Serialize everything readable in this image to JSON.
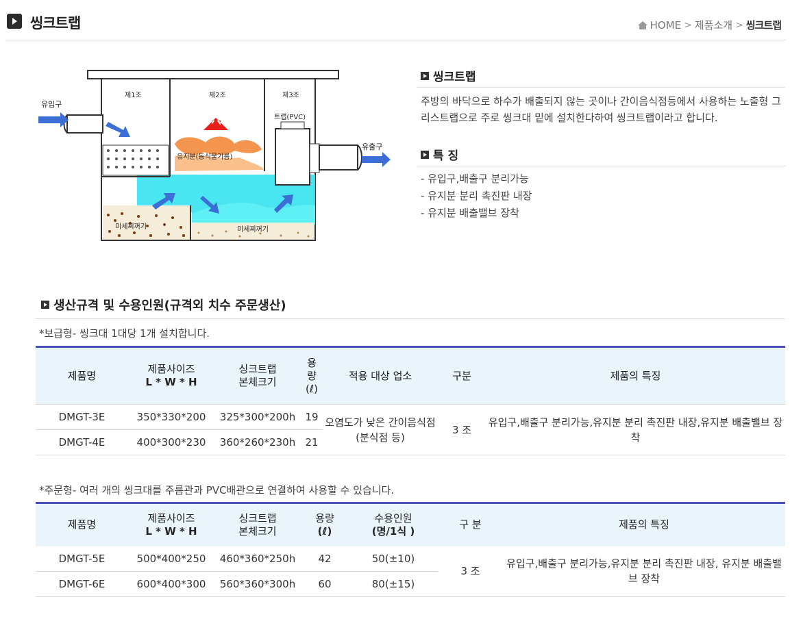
{
  "header": {
    "title": "씽크트랩",
    "breadcrumb": {
      "home": "HOME",
      "category": "제품소개",
      "current": "씽크트랩"
    }
  },
  "diagram": {
    "inlet": "유입구",
    "outlet": "유출구",
    "tank1": "제1조",
    "tank2": "제2조",
    "tank3": "제3조",
    "trap": "트랩(PVC)",
    "grease": "유지분(동식물기름)",
    "sediment1": "미세찌꺼기",
    "sediment2": "미세찌꺼기"
  },
  "intro": {
    "title": "씽크트랩",
    "description": "주방의 바닥으로 하수가 배출되지 않는 곳이나 간이음식점등에서 사용하는 노출형 그리스트랩으로 주로 씽크대 밑에 설치한다하여 씽크트랩이라고 합니다."
  },
  "features": {
    "title": "특 징",
    "items": [
      "- 유입구,배출구 분리가능",
      "- 유지분 분리 촉진판 내장",
      "- 유지분 배출밸브 장착"
    ]
  },
  "spec": {
    "title": "생산규격 및 수용인원(규격외 치수 주문생산)",
    "type1": {
      "note_label": "*보급형",
      "note_text": "- 씽크대 1대당 1개 설치합니다.",
      "headers": {
        "name": "제품명",
        "size1": "제품사이즈",
        "size2": "L * W * H",
        "body1": "싱크트랩",
        "body2": "본체크기",
        "cap1": "용",
        "cap2": "량",
        "cap3": "(ℓ)",
        "target": "적용 대상 업소",
        "div": "구분",
        "feature": "제품의 특징"
      },
      "rows": [
        {
          "name": "DMGT-3E",
          "size": "350*330*200",
          "body": "325*300*200h",
          "cap": "19"
        },
        {
          "name": "DMGT-4E",
          "size": "400*300*230",
          "body": "360*260*230h",
          "cap": "21"
        }
      ],
      "target": "오염도가 낮은 간이음식점(분식점 등)",
      "division": "3 조",
      "feature": "유입구,배출구 분리가능,유지분 분리 촉진판 내장,유지분 배출밸브 장착"
    },
    "type2": {
      "note_label": "*주문형",
      "note_text": "- 여러 개의 씽크대를 주름관과 PVC배관으로 연결하여 사용할 수 있습니다.",
      "headers": {
        "name": "제품명",
        "size1": "제품사이즈",
        "size2": "L * W * H",
        "body1": "싱크트랩",
        "body2": "본체크기",
        "cap1": "용량",
        "cap2": "(ℓ)",
        "people1": "수용인원",
        "people2": "(명/1식 )",
        "div": "구 분",
        "feature": "제품의 특징"
      },
      "rows": [
        {
          "name": "DMGT-5E",
          "size": "500*400*250",
          "body": "460*360*250h",
          "cap": "42",
          "people": "50(±10)"
        },
        {
          "name": "DMGT-6E",
          "size": "600*400*300",
          "body": "560*360*300h",
          "cap": "60",
          "people": "80(±15)"
        }
      ],
      "division": "3 조",
      "feature": "유입구,배출구 분리가능,유지분 분리 촉진판 내장, 유지분 배출밸브 장착"
    }
  },
  "colors": {
    "table_border": "#4b4fb8",
    "header_bg": "#eaf4fb",
    "water": "#35e2ee",
    "grease": "#f28a3c"
  }
}
